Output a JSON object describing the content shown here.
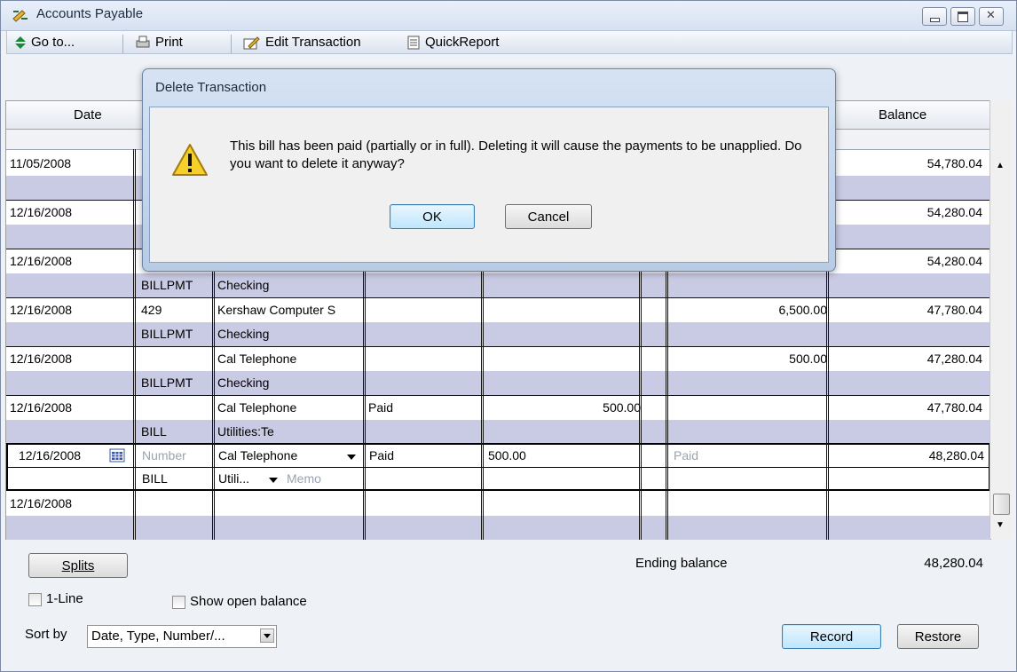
{
  "window": {
    "title": "Accounts Payable"
  },
  "toolbar": {
    "goto": "Go to...",
    "print": "Print",
    "edit_transaction": "Edit Transaction",
    "quickreport": "QuickReport"
  },
  "columns": {
    "date": "Date",
    "balance": "Balance"
  },
  "rows": [
    {
      "date": "11/05/2008",
      "number": "",
      "payee": "",
      "status": "",
      "billed": "",
      "paid": "",
      "balance": "54,780.04",
      "type": "",
      "account": ""
    },
    {
      "date": "12/16/2008",
      "number": "",
      "payee": "",
      "status": "",
      "billed": "",
      "paid": "",
      "balance": "54,280.04",
      "type": "",
      "account": ""
    },
    {
      "date": "12/16/2008",
      "number": "",
      "payee": "",
      "status": "",
      "billed": "",
      "paid": "",
      "balance": "54,280.04",
      "type": "BILLPMT",
      "account": "Checking"
    },
    {
      "date": "12/16/2008",
      "number": "429",
      "payee": "Kershaw Computer S",
      "status": "",
      "billed": "",
      "paid": "6,500.00",
      "balance": "47,780.04",
      "type": "BILLPMT",
      "account": "Checking"
    },
    {
      "date": "12/16/2008",
      "number": "",
      "payee": "Cal Telephone",
      "status": "",
      "billed": "",
      "paid": "500.00",
      "balance": "47,280.04",
      "type": "BILLPMT",
      "account": "Checking"
    },
    {
      "date": "12/16/2008",
      "number": "",
      "payee": "Cal Telephone",
      "status": "Paid",
      "billed": "500.00",
      "paid": "",
      "balance": "47,780.04",
      "type": "BILL",
      "account": "Utilities:Te"
    }
  ],
  "edit_row": {
    "date": "12/16/2008",
    "number_placeholder": "Number",
    "payee": "Cal Telephone",
    "status": "Paid",
    "billed": "500.00",
    "paid_placeholder": "Paid",
    "balance": "48,280.04",
    "type": "BILL",
    "account": "Utili...",
    "memo_placeholder": "Memo"
  },
  "blank_row": {
    "date": "12/16/2008"
  },
  "bottom": {
    "splits": "Splits",
    "ending_balance_label": "Ending balance",
    "ending_balance": "48,280.04",
    "one_line": "1-Line",
    "show_open_balance": "Show open balance",
    "sort_by_label": "Sort by",
    "sort_by_value": "Date, Type, Number/...",
    "record": "Record",
    "restore": "Restore"
  },
  "dialog": {
    "title": "Delete Transaction",
    "message": "This bill has been paid (partially or in full).  Deleting it will cause the payments to be unapplied.  Do you want to delete it anyway?",
    "ok": "OK",
    "cancel": "Cancel"
  }
}
